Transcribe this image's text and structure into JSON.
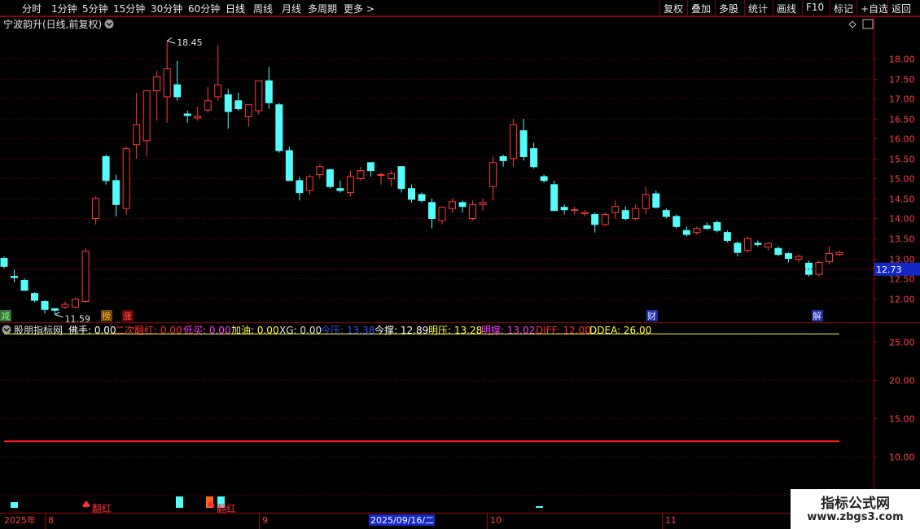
{
  "toolbar": {
    "periods": [
      "分时",
      "1分钟",
      "5分钟",
      "15分钟",
      "30分钟",
      "60分钟",
      "日线",
      "周线",
      "月线",
      "多周期",
      "更多 >"
    ],
    "active_period": "日线",
    "right_buttons": [
      "复权",
      "叠加",
      "多股",
      "统计",
      "画线",
      "F10",
      "标记",
      "+自选",
      "返回"
    ]
  },
  "stock_header": "宁波韵升(日线,前复权)",
  "colors": {
    "up": "#ff3b3b",
    "down": "#54fcfc",
    "grid": "#8a0000",
    "axis_border": "#a00000",
    "active_tab": "#ffffff"
  },
  "chart_data": [
    {
      "type": "candlestick",
      "title": "宁波韵升(日线,前复权)",
      "y_ticks": [
        12.0,
        12.5,
        13.0,
        13.5,
        14.0,
        14.5,
        15.0,
        15.5,
        16.0,
        16.5,
        17.0,
        17.5,
        18.0
      ],
      "ylim": [
        11.42,
        18.72
      ],
      "current_price": "12.73",
      "annotations": {
        "high": "18.45",
        "low": "11.59"
      },
      "markers": [
        "减",
        "榜",
        "涨",
        "财",
        "解"
      ],
      "candles": [
        {
          "o": 13.0,
          "h": 13.05,
          "l": 12.75,
          "c": 12.8
        },
        {
          "o": 12.55,
          "h": 12.72,
          "l": 12.4,
          "c": 12.52
        },
        {
          "o": 12.45,
          "h": 12.5,
          "l": 12.25,
          "c": 12.2
        },
        {
          "o": 12.12,
          "h": 12.15,
          "l": 11.9,
          "c": 11.95
        },
        {
          "o": 11.92,
          "h": 11.95,
          "l": 11.62,
          "c": 11.72
        },
        {
          "o": 11.74,
          "h": 11.76,
          "l": 11.59,
          "c": 11.7
        },
        {
          "o": 11.78,
          "h": 11.92,
          "l": 11.73,
          "c": 11.85
        },
        {
          "o": 11.78,
          "h": 12.02,
          "l": 11.75,
          "c": 11.98
        },
        {
          "o": 11.92,
          "h": 13.25,
          "l": 11.88,
          "c": 13.18
        },
        {
          "o": 14.0,
          "h": 14.55,
          "l": 13.85,
          "c": 14.5
        },
        {
          "o": 15.55,
          "h": 15.6,
          "l": 14.85,
          "c": 14.95
        },
        {
          "o": 14.95,
          "h": 15.1,
          "l": 14.05,
          "c": 14.35
        },
        {
          "o": 14.25,
          "h": 15.8,
          "l": 14.1,
          "c": 15.75
        },
        {
          "o": 15.85,
          "h": 17.15,
          "l": 15.5,
          "c": 16.35
        },
        {
          "o": 15.95,
          "h": 17.2,
          "l": 15.55,
          "c": 17.2
        },
        {
          "o": 17.2,
          "h": 17.7,
          "l": 16.45,
          "c": 17.55
        },
        {
          "o": 17.05,
          "h": 18.45,
          "l": 16.4,
          "c": 17.75
        },
        {
          "o": 17.35,
          "h": 17.95,
          "l": 16.95,
          "c": 17.05
        },
        {
          "o": 16.62,
          "h": 16.7,
          "l": 16.4,
          "c": 16.58
        },
        {
          "o": 16.52,
          "h": 16.8,
          "l": 16.45,
          "c": 16.56
        },
        {
          "o": 16.72,
          "h": 17.3,
          "l": 16.65,
          "c": 16.95
        },
        {
          "o": 17.05,
          "h": 18.35,
          "l": 16.95,
          "c": 17.35
        },
        {
          "o": 17.1,
          "h": 17.25,
          "l": 16.25,
          "c": 16.68
        },
        {
          "o": 16.95,
          "h": 17.15,
          "l": 16.7,
          "c": 16.75
        },
        {
          "o": 16.55,
          "h": 16.85,
          "l": 16.3,
          "c": 16.85
        },
        {
          "o": 16.7,
          "h": 17.45,
          "l": 16.6,
          "c": 17.45
        },
        {
          "o": 17.45,
          "h": 17.8,
          "l": 16.75,
          "c": 16.9
        },
        {
          "o": 16.85,
          "h": 16.9,
          "l": 15.65,
          "c": 15.7
        },
        {
          "o": 15.7,
          "h": 15.8,
          "l": 15.0,
          "c": 14.95
        },
        {
          "o": 14.95,
          "h": 15.05,
          "l": 14.45,
          "c": 14.65
        },
        {
          "o": 14.7,
          "h": 15.1,
          "l": 14.6,
          "c": 15.05
        },
        {
          "o": 15.1,
          "h": 15.35,
          "l": 15.0,
          "c": 15.3
        },
        {
          "o": 15.22,
          "h": 15.25,
          "l": 14.75,
          "c": 14.8
        },
        {
          "o": 14.75,
          "h": 14.95,
          "l": 14.65,
          "c": 14.7
        },
        {
          "o": 14.65,
          "h": 15.2,
          "l": 14.55,
          "c": 15.05
        },
        {
          "o": 15.0,
          "h": 15.3,
          "l": 14.95,
          "c": 15.2
        },
        {
          "o": 15.4,
          "h": 15.4,
          "l": 15.05,
          "c": 15.2
        },
        {
          "o": 15.1,
          "h": 15.15,
          "l": 14.85,
          "c": 15.1
        },
        {
          "o": 15.0,
          "h": 15.2,
          "l": 14.8,
          "c": 15.12
        },
        {
          "o": 15.3,
          "h": 15.3,
          "l": 14.65,
          "c": 14.75
        },
        {
          "o": 14.75,
          "h": 14.85,
          "l": 14.4,
          "c": 14.48
        },
        {
          "o": 14.6,
          "h": 14.65,
          "l": 14.4,
          "c": 14.45
        },
        {
          "o": 14.4,
          "h": 14.5,
          "l": 13.75,
          "c": 14.0
        },
        {
          "o": 13.95,
          "h": 14.3,
          "l": 13.85,
          "c": 14.28
        },
        {
          "o": 14.25,
          "h": 14.5,
          "l": 14.15,
          "c": 14.42
        },
        {
          "o": 14.4,
          "h": 14.45,
          "l": 14.15,
          "c": 14.3
        },
        {
          "o": 14.0,
          "h": 14.45,
          "l": 13.95,
          "c": 14.35
        },
        {
          "o": 14.35,
          "h": 14.5,
          "l": 14.2,
          "c": 14.4
        },
        {
          "o": 14.8,
          "h": 15.55,
          "l": 14.45,
          "c": 15.4
        },
        {
          "o": 15.55,
          "h": 15.6,
          "l": 15.3,
          "c": 15.45
        },
        {
          "o": 15.5,
          "h": 16.5,
          "l": 15.3,
          "c": 16.35
        },
        {
          "o": 16.2,
          "h": 16.5,
          "l": 15.45,
          "c": 15.55
        },
        {
          "o": 15.75,
          "h": 15.9,
          "l": 15.25,
          "c": 15.3
        },
        {
          "o": 15.05,
          "h": 15.1,
          "l": 14.9,
          "c": 14.95
        },
        {
          "o": 14.85,
          "h": 14.95,
          "l": 14.2,
          "c": 14.2
        },
        {
          "o": 14.28,
          "h": 14.35,
          "l": 14.1,
          "c": 14.22
        },
        {
          "o": 14.2,
          "h": 14.3,
          "l": 14.1,
          "c": 14.22
        },
        {
          "o": 14.12,
          "h": 14.2,
          "l": 14.05,
          "c": 14.15
        },
        {
          "o": 14.1,
          "h": 14.15,
          "l": 13.65,
          "c": 13.85
        },
        {
          "o": 13.85,
          "h": 14.15,
          "l": 13.8,
          "c": 14.1
        },
        {
          "o": 14.15,
          "h": 14.45,
          "l": 14.0,
          "c": 14.3
        },
        {
          "o": 14.2,
          "h": 14.3,
          "l": 13.95,
          "c": 14.0
        },
        {
          "o": 14.0,
          "h": 14.35,
          "l": 13.95,
          "c": 14.25
        },
        {
          "o": 14.25,
          "h": 14.8,
          "l": 14.1,
          "c": 14.6
        },
        {
          "o": 14.62,
          "h": 14.7,
          "l": 14.25,
          "c": 14.28
        },
        {
          "o": 14.2,
          "h": 14.25,
          "l": 14.0,
          "c": 14.05
        },
        {
          "o": 14.05,
          "h": 14.1,
          "l": 13.75,
          "c": 13.8
        },
        {
          "o": 13.7,
          "h": 13.8,
          "l": 13.55,
          "c": 13.6
        },
        {
          "o": 13.65,
          "h": 13.8,
          "l": 13.6,
          "c": 13.75
        },
        {
          "o": 13.82,
          "h": 13.9,
          "l": 13.72,
          "c": 13.75
        },
        {
          "o": 13.9,
          "h": 13.95,
          "l": 13.65,
          "c": 13.7
        },
        {
          "o": 13.65,
          "h": 13.7,
          "l": 13.4,
          "c": 13.45
        },
        {
          "o": 13.38,
          "h": 13.42,
          "l": 13.05,
          "c": 13.15
        },
        {
          "o": 13.2,
          "h": 13.55,
          "l": 13.15,
          "c": 13.5
        },
        {
          "o": 13.38,
          "h": 13.45,
          "l": 13.3,
          "c": 13.35
        },
        {
          "o": 13.28,
          "h": 13.4,
          "l": 13.2,
          "c": 13.38
        },
        {
          "o": 13.25,
          "h": 13.3,
          "l": 13.05,
          "c": 13.1
        },
        {
          "o": 13.12,
          "h": 13.15,
          "l": 12.9,
          "c": 13.0
        },
        {
          "o": 12.98,
          "h": 13.1,
          "l": 12.9,
          "c": 13.05
        },
        {
          "o": 12.88,
          "h": 12.95,
          "l": 12.55,
          "c": 12.6
        },
        {
          "o": 12.6,
          "h": 12.95,
          "l": 12.55,
          "c": 12.9
        },
        {
          "o": 12.92,
          "h": 13.3,
          "l": 12.85,
          "c": 13.12
        },
        {
          "o": 13.1,
          "h": 13.2,
          "l": 13.05,
          "c": 13.15
        }
      ]
    },
    {
      "type": "line",
      "title": "股朋指标网",
      "y_ticks": [
        5.0,
        10.0,
        15.0,
        20.0,
        25.0
      ],
      "ylim": [
        2.8,
        27.3
      ],
      "series": [
        {
          "name": "DDEA",
          "color": "#ffff40",
          "value": 26.0
        },
        {
          "name": "DIFF",
          "color": "#ff2020",
          "value": 12.0
        }
      ]
    }
  ],
  "indicator_legend": [
    {
      "label": "佛手: 0.00",
      "color": "#ffffff"
    },
    {
      "label": "二次翻红: 0.00",
      "color": "#ff3030"
    },
    {
      "label": "低买: 0.00",
      "color": "#ff40ff"
    },
    {
      "label": "加油: 0.00",
      "color": "#ffff40"
    },
    {
      "label": "XG: 0.00",
      "color": "#e0e0e0"
    },
    {
      "label": "今压: 13.38",
      "color": "#3050ff"
    },
    {
      "label": "今撑: 12.89",
      "color": "#ffffff"
    },
    {
      "label": "明压: 13.28",
      "color": "#ffff40"
    },
    {
      "label": "明撑: 13.02",
      "color": "#ff40ff"
    },
    {
      "label": "DIFF: 12.00",
      "color": "#ff3030"
    },
    {
      "label": "DDEA: 26.00",
      "color": "#ffff40"
    }
  ],
  "signal_labels": [
    "翻红",
    "翻红"
  ],
  "x_axis": {
    "year_label": "2025年",
    "month_labels": [
      "8",
      "9",
      "10",
      "11"
    ],
    "cursor_date": "2025/09/16/二"
  },
  "watermark": {
    "title": "指标公式网",
    "url": "www.zbgs3.com"
  }
}
